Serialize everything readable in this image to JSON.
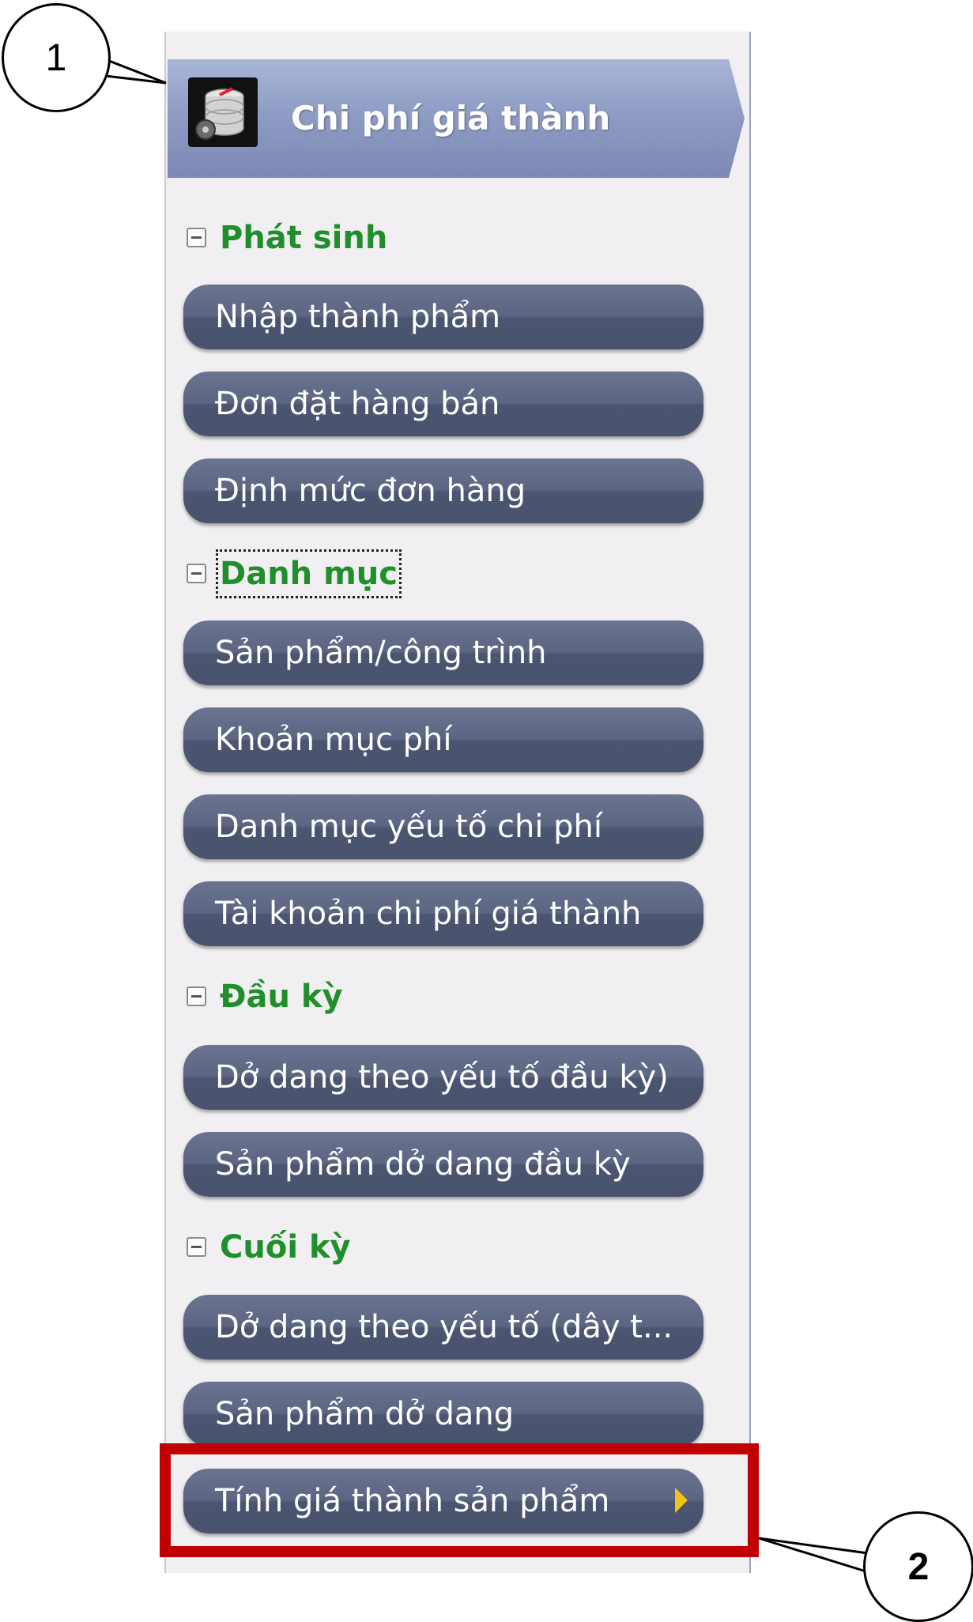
{
  "header": {
    "title": "Chi phí giá thành",
    "icon": "database-settings-icon"
  },
  "sections": [
    {
      "label": "Phát sinh",
      "items": [
        "Nhập thành phẩm",
        "Đơn đặt hàng bán",
        "Định mức đơn hàng"
      ]
    },
    {
      "label": "Danh mục",
      "items": [
        "Sản phẩm/công trình",
        "Khoản mục phí",
        "Danh mục yếu tố chi phí",
        "Tài khoản chi phí giá thành"
      ]
    },
    {
      "label": "Đầu kỳ",
      "items": [
        "Dở dang theo yếu tố đầu kỳ)",
        "Sản phẩm dở dang đầu kỳ"
      ]
    },
    {
      "label": "Cuối kỳ",
      "items": [
        "Dở dang theo yếu tố (dây t...",
        "Sản phẩm dở dang",
        "Tính giá thành sản phẩm"
      ]
    }
  ],
  "callouts": {
    "first": "1",
    "second": "2"
  },
  "colors": {
    "section_label": "#1e8f2b",
    "button_bg": "#5c6682",
    "highlight_box": "#c00000",
    "arrow": "#f1c21b"
  }
}
